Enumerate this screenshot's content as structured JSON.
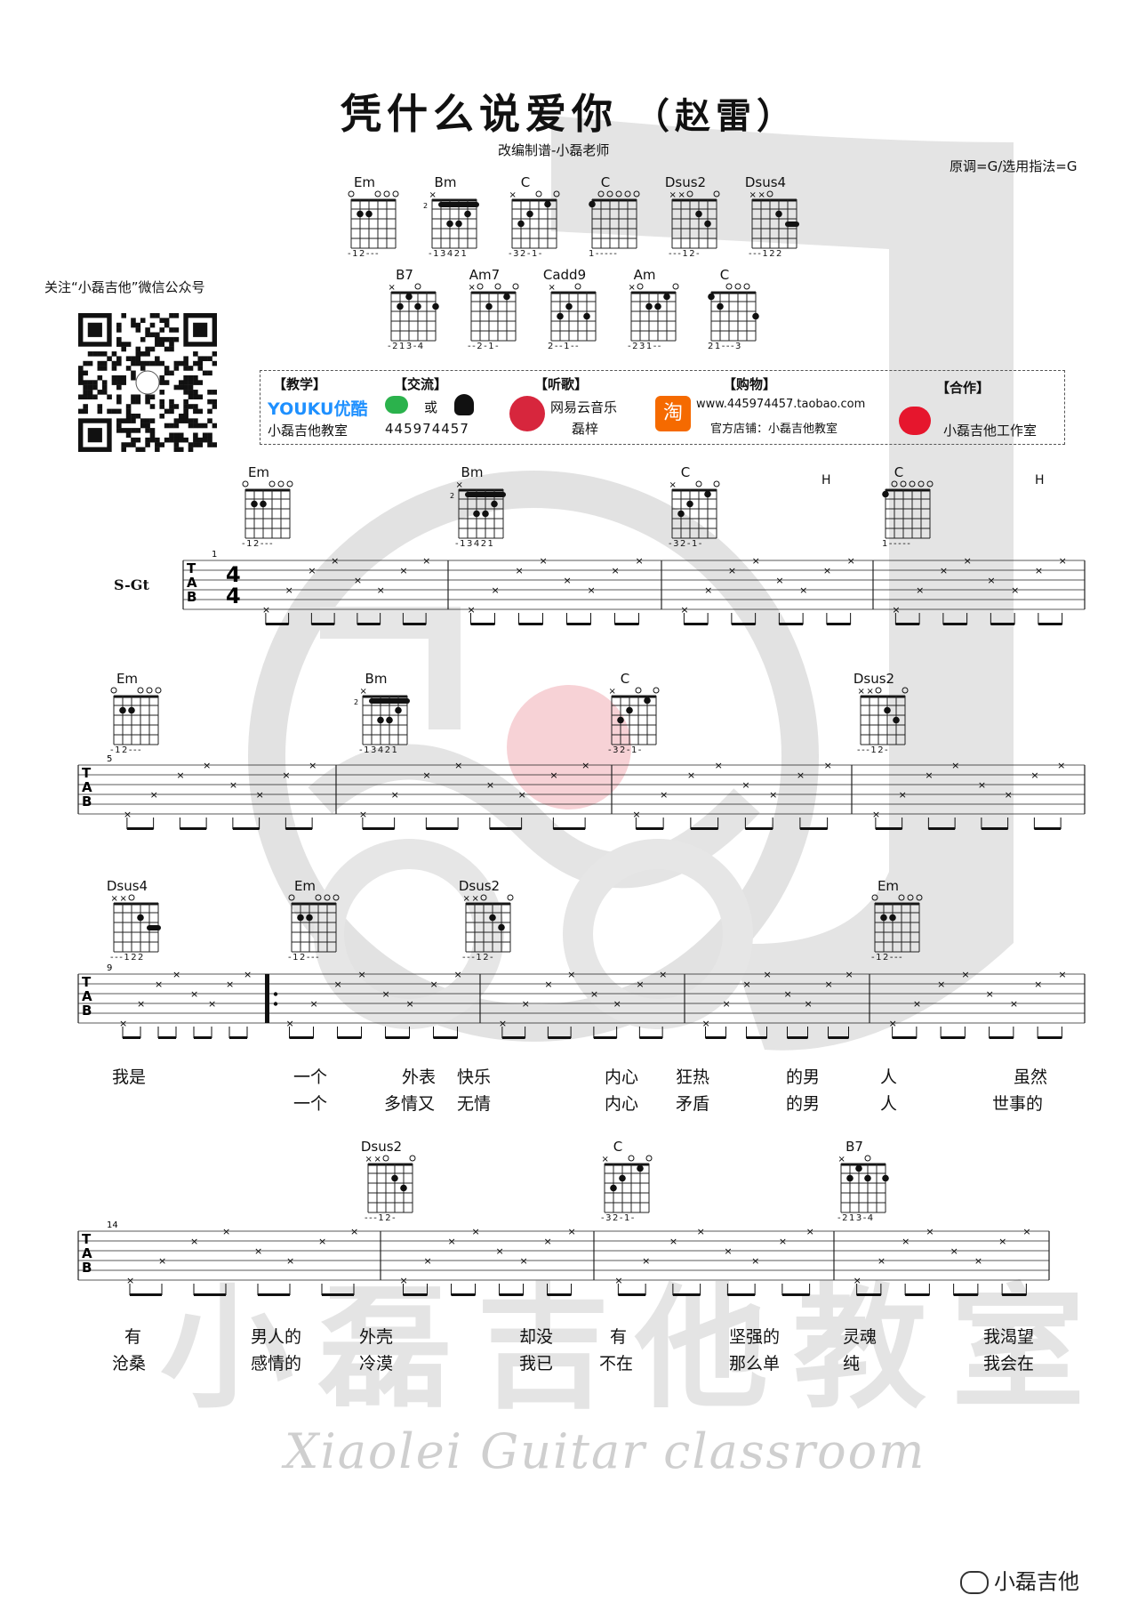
{
  "header": {
    "title": "凭什么说爱你",
    "artist": "（赵雷）",
    "subtitle": "改编制谱-小磊老师",
    "key_info": "原调=G/选用指法=G"
  },
  "wechat_label": "关注“小磊吉他”微信公众号",
  "promo": {
    "teach_header": "【教学】",
    "teach_logo": "YOUKU优酷",
    "teach_name": "小磊吉他教室",
    "chat_header": "【交流】",
    "chat_or": "或",
    "chat_qq": "445974457",
    "listen_header": "【听歌】",
    "listen_app": "网易云音乐",
    "listen_artist": "磊梓",
    "shop_header": "【购物】",
    "shop_url": "www.445974457.taobao.com",
    "shop_store": "官方店铺：小磊吉他教室",
    "coop_header": "【合作】",
    "coop_name": "小磊吉他工作室"
  },
  "chord_chart": {
    "row1": [
      {
        "name": "Em",
        "fingering": "-12---"
      },
      {
        "name": "Bm",
        "fingering": "-13421"
      },
      {
        "name": "C",
        "fingering": "-32-1-"
      },
      {
        "name": "C",
        "fingering": "1-----"
      },
      {
        "name": "Dsus2",
        "fingering": "---12-"
      },
      {
        "name": "Dsus4",
        "fingering": "---122"
      }
    ],
    "row2": [
      {
        "name": "B7",
        "fingering": "-213-4"
      },
      {
        "name": "Am7",
        "fingering": "--2-1-"
      },
      {
        "name": "Cadd9",
        "fingering": "2--1--"
      },
      {
        "name": "Am",
        "fingering": "-231--"
      },
      {
        "name": "C",
        "fingering": "21---3"
      }
    ]
  },
  "score": {
    "instrument": "S-Gt",
    "h_marks": [
      "H",
      "H"
    ],
    "systems": [
      {
        "measure": "1",
        "chords": [
          "Em",
          "Bm",
          "C",
          "C"
        ],
        "fingerings": [
          "-12---",
          "-13421",
          "-32-1-",
          "1-----"
        ]
      },
      {
        "measure": "5",
        "chords": [
          "Em",
          "Bm",
          "C",
          "Dsus2"
        ],
        "fingerings": [
          "-12---",
          "-13421",
          "-32-1-",
          "---12-"
        ]
      },
      {
        "measure": "9",
        "chords": [
          "Dsus4",
          "Em",
          "Dsus2",
          "Em"
        ],
        "fingerings": [
          "---122",
          "-12---",
          "---12-",
          "-12---"
        ]
      },
      {
        "measure": "14",
        "chords": [
          "Dsus2",
          "C",
          "B7"
        ],
        "fingerings": [
          "---12-",
          "-32-1-",
          "-213-4"
        ]
      }
    ]
  },
  "lyrics": {
    "sys3_line1": [
      "我是",
      "一个",
      "外表",
      "快乐",
      "内心",
      "狂热",
      "的男",
      "人",
      "虽然"
    ],
    "sys3_line2": [
      "一个",
      "多情又",
      "无情",
      "内心",
      "矛盾",
      "的男",
      "人",
      "世事的"
    ],
    "sys4_line1": [
      "有",
      "男人的",
      "外壳",
      "却没",
      "有",
      "坚强的",
      "灵魂",
      "我渴望"
    ],
    "sys4_line2": [
      "沧桑",
      "感情的",
      "冷漠",
      "我已",
      "不在",
      "那么单",
      "纯",
      "我会在"
    ]
  },
  "watermark": {
    "cn": "小磊吉他教室",
    "en": "Xiaolei Guitar classroom"
  },
  "footer_label": "小磊吉他"
}
